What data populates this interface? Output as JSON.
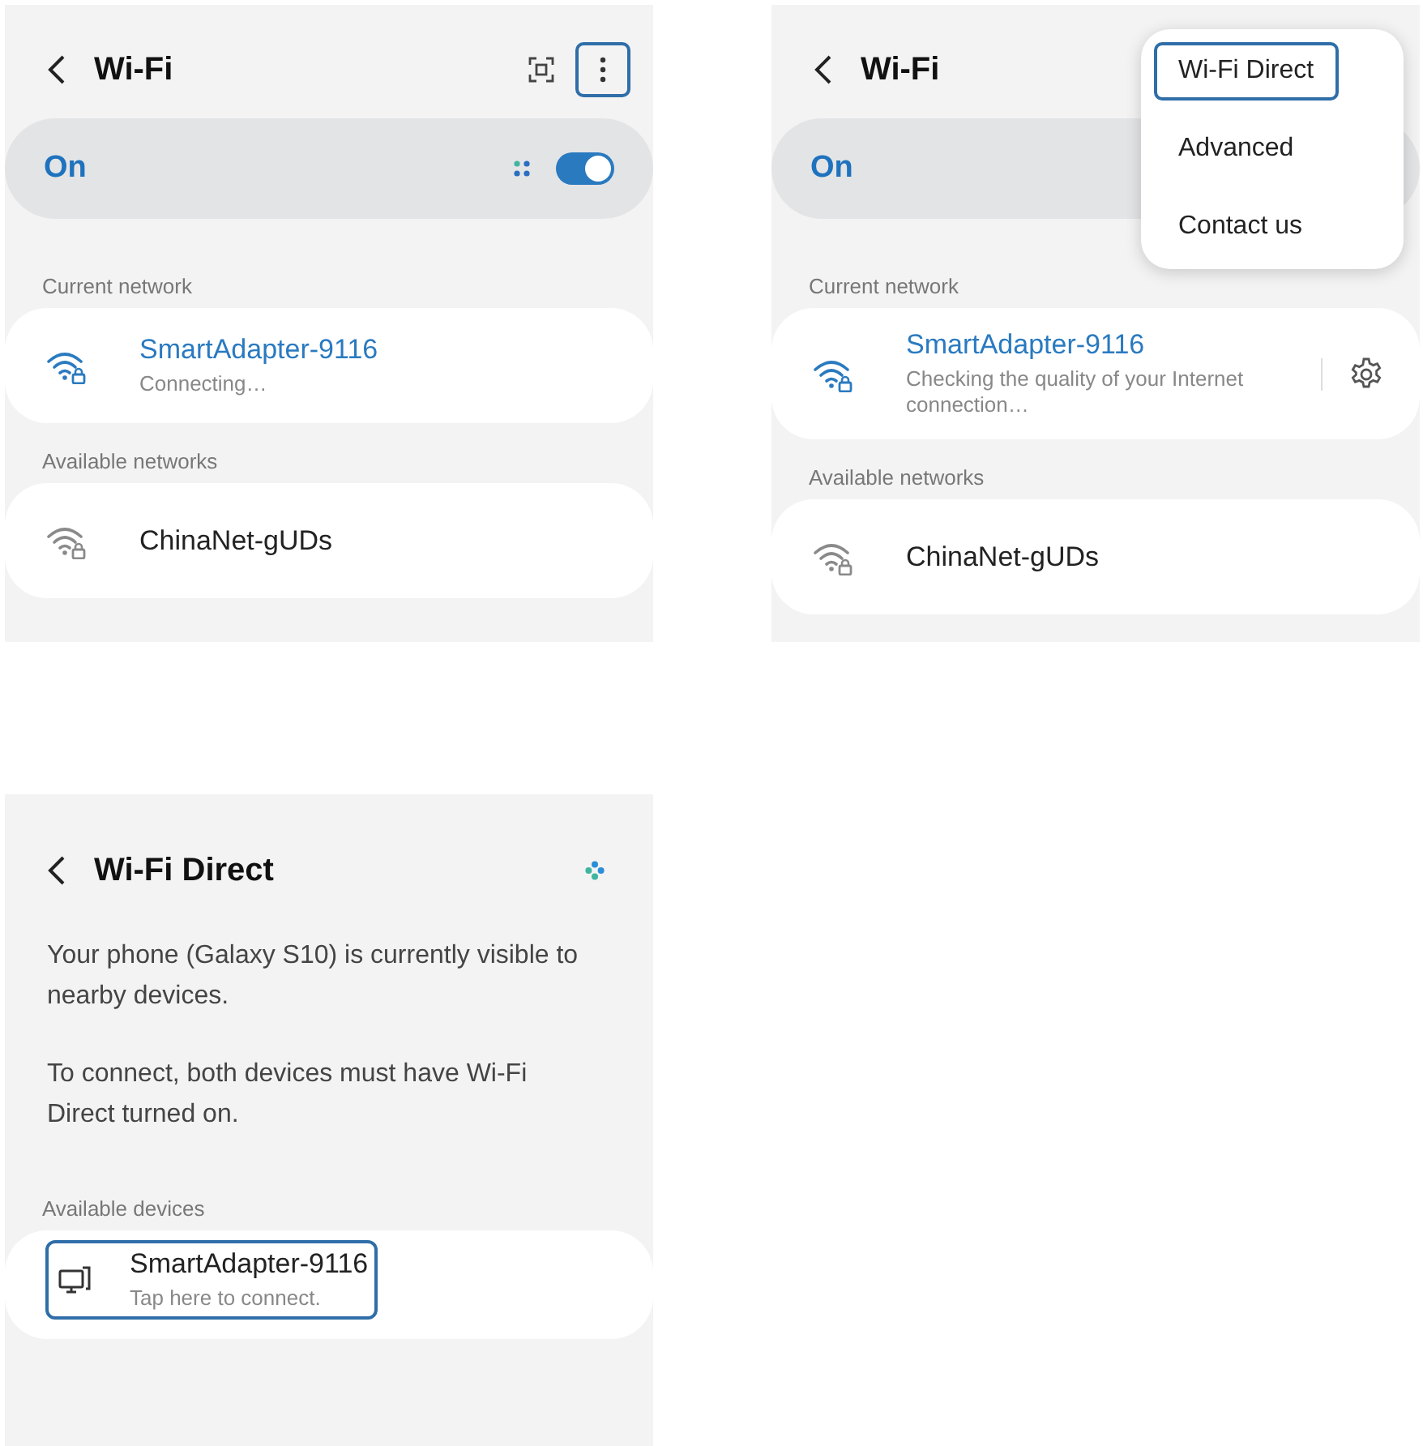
{
  "screens": [
    {
      "kind": "wifi",
      "title": "Wi-Fi",
      "actions": [
        {
          "kind": "qr",
          "highlighted": false
        },
        {
          "kind": "more",
          "highlighted": true
        }
      ],
      "switch": {
        "label": "On",
        "on": true,
        "scanning": true
      },
      "sections": [
        {
          "header": "Current network",
          "networks": [
            {
              "name": "SmartAdapter-9116",
              "status": "Connecting…",
              "connected": true,
              "settings": false
            }
          ]
        },
        {
          "header": "Available networks",
          "networks": [
            {
              "name": "ChinaNet-gUDs",
              "connected": false,
              "settings": false
            }
          ]
        }
      ]
    },
    {
      "kind": "wifi",
      "title": "Wi-Fi",
      "switch": {
        "label": "On"
      },
      "sections": [
        {
          "header": "Current network",
          "networks": [
            {
              "name": "SmartAdapter-9116",
              "status": "Checking the quality of your Internet connection…",
              "connected": true,
              "settings": true
            }
          ]
        },
        {
          "header": "Available networks",
          "networks": [
            {
              "name": "ChinaNet-gUDs",
              "connected": false,
              "settings": false
            }
          ]
        }
      ],
      "menu": [
        {
          "label": "Wi-Fi Direct",
          "highlighted": true
        },
        {
          "label": "Advanced",
          "highlighted": false
        },
        {
          "label": "Contact us",
          "highlighted": false
        }
      ]
    },
    {
      "kind": "direct",
      "title": "Wi-Fi Direct",
      "searching": true,
      "paragraphs": [
        "Your phone (Galaxy S10) is currently visible to nearby devices.",
        "To connect, both devices must have Wi-Fi Direct turned on."
      ],
      "sections": [
        {
          "header": "Available devices",
          "devices": [
            {
              "name": "SmartAdapter-9116",
              "status": "Tap here to connect.",
              "highlighted": true
            }
          ]
        }
      ]
    }
  ]
}
